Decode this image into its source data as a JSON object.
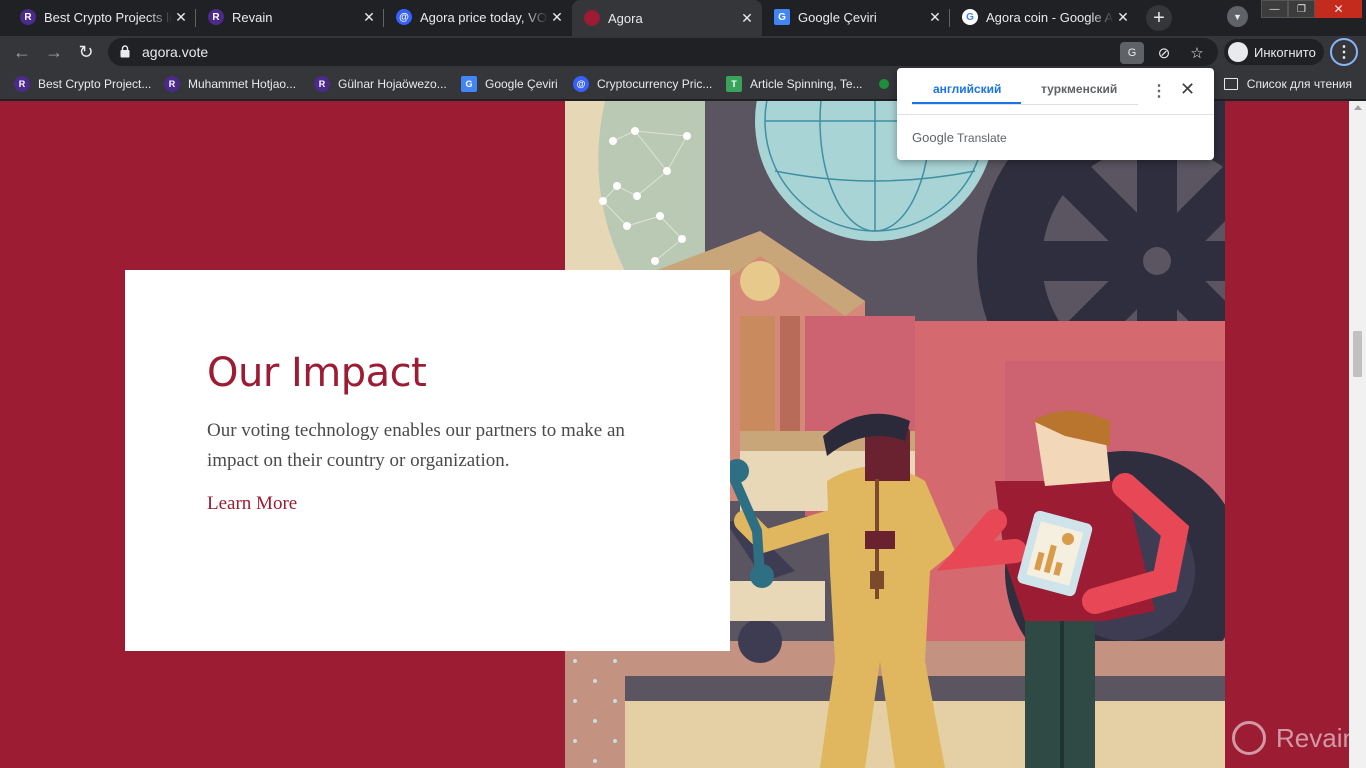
{
  "browser": {
    "tabs": [
      {
        "title": "Best Crypto Projects list",
        "icon": "revain-icon",
        "active": false
      },
      {
        "title": "Revain",
        "icon": "revain-icon",
        "active": false
      },
      {
        "title": "Agora price today, VOTE",
        "icon": "coinmarket-icon",
        "active": false
      },
      {
        "title": "Agora",
        "icon": "agora-icon",
        "active": true
      },
      {
        "title": "Google Çeviri",
        "icon": "google-translate-icon",
        "active": false
      },
      {
        "title": "Agora coin - Google Ara",
        "icon": "google-icon",
        "active": false
      }
    ],
    "url": "agora.vote",
    "profile_label": "Инкогнито",
    "bookmarks": [
      {
        "label": "Best Crypto Project...",
        "icon": "revain-icon"
      },
      {
        "label": "Muhammet Hotjao...",
        "icon": "revain-icon"
      },
      {
        "label": "Gülnar Hojaöwezo...",
        "icon": "revain-icon"
      },
      {
        "label": "Google Çeviri",
        "icon": "google-translate-icon"
      },
      {
        "label": "Cryptocurrency Pric...",
        "icon": "coinmarket-icon"
      },
      {
        "label": "Article Spinning, Te...",
        "icon": "spinner-icon"
      }
    ],
    "reading_list_label": "Список для чтения"
  },
  "translate_popup": {
    "source_language": "английский",
    "target_language": "туркменский",
    "brand_google": "Google",
    "brand_translate": "Translate"
  },
  "page": {
    "section_title": "Our Impact",
    "description": "Our voting technology enables our partners to make an impact on their country or organization.",
    "link_label": "Learn More",
    "watermark": "Revain"
  },
  "colors": {
    "brand": "#9b1c33",
    "card_bg": "#ffffff",
    "body_text": "#4a4a4a",
    "accent_blue": "#1a73e8"
  }
}
